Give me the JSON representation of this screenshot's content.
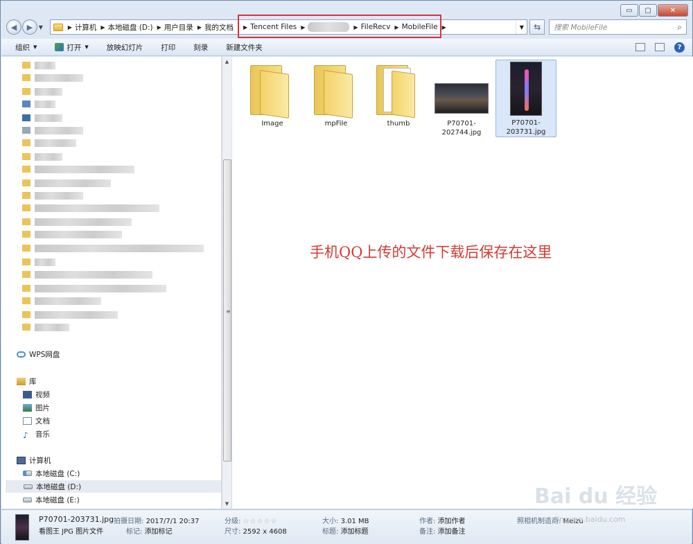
{
  "window": {
    "controls": {
      "minimize": "▭",
      "maximize": "▢",
      "close": "✕"
    }
  },
  "nav": {
    "back_glyph": "◀",
    "forward_glyph": "▶",
    "breadcrumbs": [
      "计算机",
      "本地磁盘 (D:)",
      "用户目录",
      "我的文档",
      "Tencent Files",
      "",
      "FileRecv",
      "MobileFile"
    ],
    "search_placeholder": "搜索 MobileFile"
  },
  "toolbar": {
    "organize": "组织",
    "open": "打开",
    "slideshow": "放映幻灯片",
    "print": "打印",
    "burn": "刻录",
    "new_folder": "新建文件夹"
  },
  "sidebar": {
    "wps": "WPS网盘",
    "library": "库",
    "lib_items": [
      "视频",
      "图片",
      "文档",
      "音乐"
    ],
    "computer": "计算机",
    "drives": [
      "本地磁盘 (C:)",
      "本地磁盘 (D:)",
      "本地磁盘 (E:)"
    ]
  },
  "files": [
    {
      "name": "Image",
      "kind": "folder"
    },
    {
      "name": "mpFile",
      "kind": "folder"
    },
    {
      "name": "thumb",
      "kind": "folder-docs"
    },
    {
      "name": "P70701-202744.jpg",
      "kind": "image"
    },
    {
      "name": "P70701-203731.jpg",
      "kind": "image",
      "selected": true
    }
  ],
  "annotation": "手机QQ上传的文件下载后保存在这里",
  "details": {
    "filename": "P70701-203731.jpg",
    "filetype": "看图王 JPG 图片文件",
    "date_label": "拍摄日期:",
    "date_value": "2017/7/1 20:37",
    "tag_label": "标记:",
    "tag_value": "添加标记",
    "rating_label": "分级:",
    "rating_stars": "☆☆☆☆☆",
    "dim_label": "尺寸:",
    "dim_value": "2592 x 4608",
    "size_label": "大小:",
    "size_value": "3.01 MB",
    "title_label": "标题:",
    "title_value": "添加标题",
    "author_label": "作者:",
    "author_value": "添加作者",
    "comment_label": "备注:",
    "comment_value": "添加备注",
    "camera_label": "照相机制造商:",
    "camera_value": "Meizu"
  },
  "watermark": {
    "main": "Bai du 经验",
    "sub": "jingyan.baidu.com"
  },
  "colors": {
    "annotation": "#d43a32",
    "highlight_box": "#d8333b",
    "selection": "#d9e7f8"
  }
}
